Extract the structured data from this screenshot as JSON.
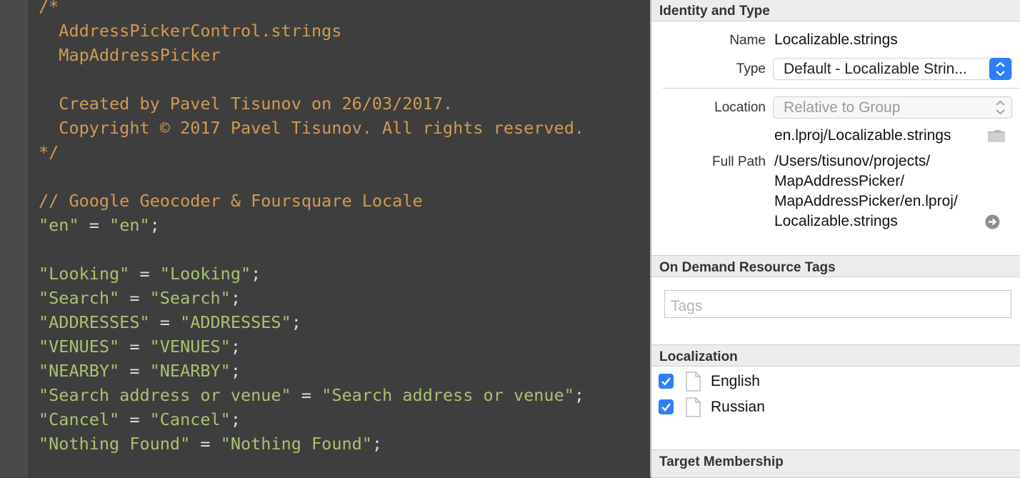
{
  "editor": {
    "lines": [
      {
        "text": "/*",
        "kind": "cm"
      },
      {
        "text": "  AddressPickerControl.strings",
        "kind": "cm"
      },
      {
        "text": "  MapAddressPicker",
        "kind": "cm"
      },
      {
        "text": "",
        "kind": "cm"
      },
      {
        "text": "  Created by Pavel Tisunov on 26/03/2017.",
        "kind": "cm"
      },
      {
        "text": "  Copyright © 2017 Pavel Tisunov. All rights reserved.",
        "kind": "cm"
      },
      {
        "text": "*/",
        "kind": "cm"
      },
      {
        "text": "",
        "kind": "cm"
      },
      {
        "text": "// Google Geocoder & Foursquare Locale",
        "kind": "cm"
      },
      {
        "key": "\"en\"",
        "value": "\"en\"",
        "kind": "kv"
      },
      {
        "text": "",
        "kind": "cm"
      },
      {
        "key": "\"Looking\"",
        "value": "\"Looking\"",
        "kind": "kv"
      },
      {
        "key": "\"Search\"",
        "value": "\"Search\"",
        "kind": "kv"
      },
      {
        "key": "\"ADDRESSES\"",
        "value": "\"ADDRESSES\"",
        "kind": "kv"
      },
      {
        "key": "\"VENUES\"",
        "value": "\"VENUES\"",
        "kind": "kv"
      },
      {
        "key": "\"NEARBY\"",
        "value": "\"NEARBY\"",
        "kind": "kv"
      },
      {
        "key": "\"Search address or venue\"",
        "value": "\"Search address or venue\"",
        "kind": "kv"
      },
      {
        "key": "\"Cancel\"",
        "value": "\"Cancel\"",
        "kind": "kv"
      },
      {
        "key": "\"Nothing Found\"",
        "value": "\"Nothing Found\"",
        "kind": "kv"
      }
    ],
    "equals": " = ",
    "semicolon": ";"
  },
  "inspector": {
    "identity": {
      "header": "Identity and Type",
      "name_label": "Name",
      "name_value": "Localizable.strings",
      "type_label": "Type",
      "type_value": "Default - Localizable Strin...",
      "location_label": "Location",
      "location_value": "Relative to Group",
      "relative_path": "en.lproj/Localizable.strings",
      "full_path_label": "Full Path",
      "full_path_lines": [
        "/Users/tisunov/projects/",
        "MapAddressPicker/",
        "MapAddressPicker/en.lproj/",
        "Localizable.strings"
      ]
    },
    "on_demand": {
      "header": "On Demand Resource Tags",
      "tags_placeholder": "Tags"
    },
    "localization": {
      "header": "Localization",
      "languages": [
        {
          "name": "English",
          "checked": true
        },
        {
          "name": "Russian",
          "checked": true
        }
      ]
    },
    "target_membership": {
      "header": "Target Membership"
    }
  },
  "colors": {
    "comment": "#d19a55",
    "string": "#a9c272",
    "accent": "#2d7ef7"
  }
}
